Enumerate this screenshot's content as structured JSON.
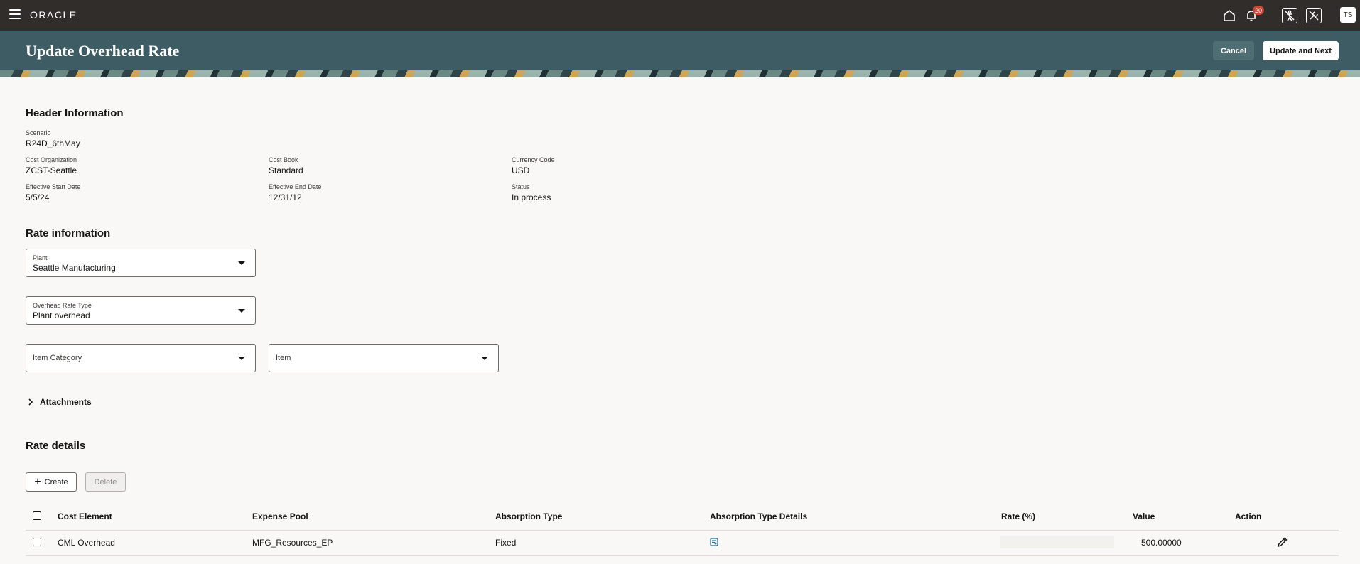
{
  "topbar": {
    "logo": "ORACLE",
    "notification_count": "20",
    "avatar_initials": "TS"
  },
  "header": {
    "title": "Update Overhead Rate",
    "cancel_label": "Cancel",
    "update_next_label": "Update and Next"
  },
  "header_info": {
    "section_title": "Header Information",
    "scenario_label": "Scenario",
    "scenario_value": "R24D_6thMay",
    "cost_org_label": "Cost Organization",
    "cost_org_value": "ZCST-Seattle",
    "cost_book_label": "Cost Book",
    "cost_book_value": "Standard",
    "currency_label": "Currency Code",
    "currency_value": "USD",
    "start_date_label": "Effective Start Date",
    "start_date_value": "5/5/24",
    "end_date_label": "Effective End Date",
    "end_date_value": "12/31/12",
    "status_label": "Status",
    "status_value": "In process"
  },
  "rate_info": {
    "section_title": "Rate information",
    "plant_label": "Plant",
    "plant_value": "Seattle Manufacturing",
    "overhead_type_label": "Overhead Rate Type",
    "overhead_type_value": "Plant overhead",
    "item_category_placeholder": "Item Category",
    "item_placeholder": "Item",
    "attachments_label": "Attachments"
  },
  "rate_details": {
    "section_title": "Rate details",
    "create_label": "Create",
    "delete_label": "Delete",
    "columns": {
      "cost_element": "Cost Element",
      "expense_pool": "Expense Pool",
      "absorption_type": "Absorption Type",
      "absorption_details": "Absorption Type Details",
      "rate": "Rate (%)",
      "value": "Value",
      "action": "Action"
    },
    "rows": [
      {
        "cost_element": "CML Overhead",
        "expense_pool": "MFG_Resources_EP",
        "absorption_type": "Fixed",
        "rate": "",
        "value": "500.00000"
      }
    ]
  },
  "colors": {
    "topbar": "#312d2a",
    "header_band": "#3d5c63",
    "badge": "#c74634",
    "detail_icon": "#2d6f9a"
  }
}
